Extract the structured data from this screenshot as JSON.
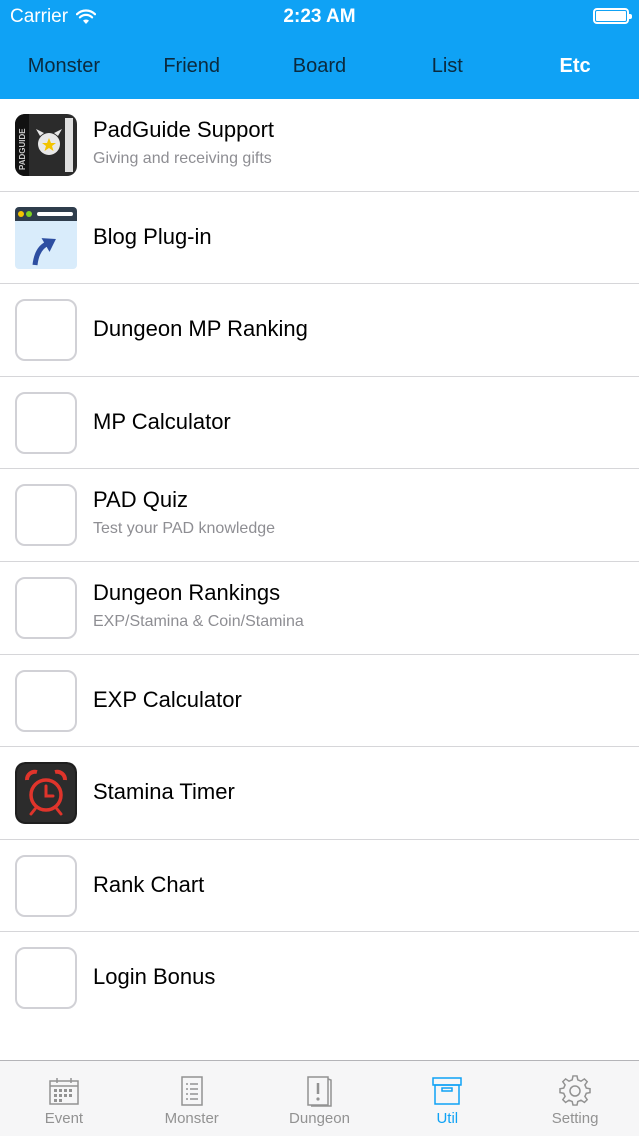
{
  "status_bar": {
    "carrier": "Carrier",
    "time": "2:23 AM"
  },
  "top_tabs": [
    {
      "label": "Monster"
    },
    {
      "label": "Friend"
    },
    {
      "label": "Board"
    },
    {
      "label": "List"
    },
    {
      "label": "Etc",
      "active": true
    }
  ],
  "rows": [
    {
      "title": "PadGuide Support",
      "subtitle": "Giving and receiving gifts",
      "icon": "padguide-book-icon",
      "icon_text": "PADGUIDE"
    },
    {
      "title": "Blog Plug-in",
      "subtitle": "",
      "icon": "browser-upload-icon"
    },
    {
      "title": "Dungeon MP Ranking",
      "subtitle": "",
      "icon": "placeholder-icon"
    },
    {
      "title": "MP Calculator",
      "subtitle": "",
      "icon": "placeholder-icon"
    },
    {
      "title": "PAD Quiz",
      "subtitle": "Test your PAD knowledge",
      "icon": "placeholder-icon"
    },
    {
      "title": "Dungeon Rankings",
      "subtitle": "EXP/Stamina & Coin/Stamina",
      "icon": "placeholder-icon"
    },
    {
      "title": "EXP Calculator",
      "subtitle": "",
      "icon": "placeholder-icon"
    },
    {
      "title": "Stamina Timer",
      "subtitle": "",
      "icon": "alarm-clock-icon"
    },
    {
      "title": "Rank Chart",
      "subtitle": "",
      "icon": "placeholder-icon"
    },
    {
      "title": "Login Bonus",
      "subtitle": "",
      "icon": "placeholder-icon"
    }
  ],
  "tab_bar": [
    {
      "label": "Event",
      "icon": "calendar-icon"
    },
    {
      "label": "Monster",
      "icon": "list-document-icon"
    },
    {
      "label": "Dungeon",
      "icon": "alert-book-icon"
    },
    {
      "label": "Util",
      "icon": "archive-box-icon",
      "active": true
    },
    {
      "label": "Setting",
      "icon": "gear-icon"
    }
  ],
  "colors": {
    "accent": "#0fa2f5",
    "separator": "#d6d6d9",
    "subtitle": "#8e8e93",
    "tab_inactive": "#929292"
  }
}
